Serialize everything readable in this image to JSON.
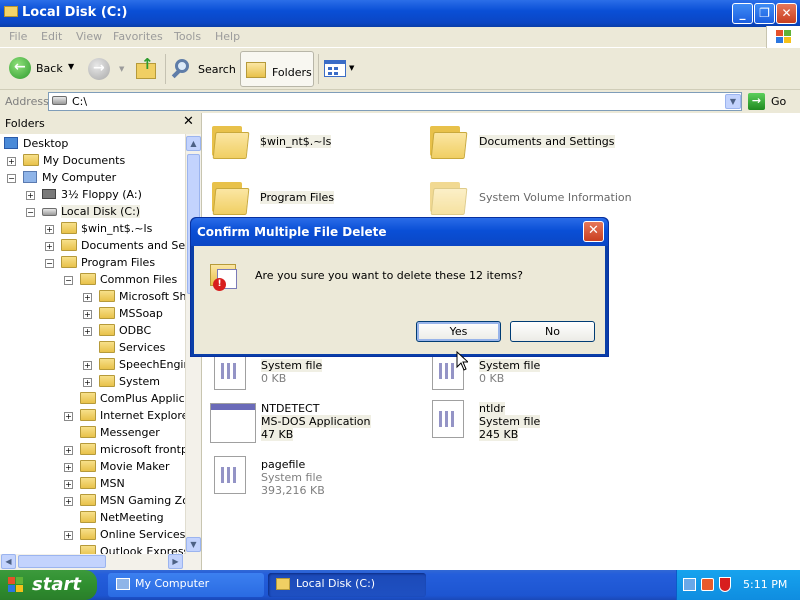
{
  "window": {
    "title": "Local Disk (C:)"
  },
  "menu": [
    "File",
    "Edit",
    "View",
    "Favorites",
    "Tools",
    "Help"
  ],
  "toolbar": {
    "back": "Back",
    "search": "Search",
    "folders": "Folders"
  },
  "address": {
    "label": "Address",
    "value": "C:\\",
    "go": "Go"
  },
  "folders_pane": {
    "title": "Folders",
    "tree": [
      {
        "label": "Desktop"
      },
      {
        "label": "My Documents"
      },
      {
        "label": "My Computer"
      },
      {
        "label": "3½ Floppy (A:)"
      },
      {
        "label": "Local Disk (C:)"
      },
      {
        "label": "$win_nt$.~ls"
      },
      {
        "label": "Documents and Settir"
      },
      {
        "label": "Program Files"
      },
      {
        "label": "Common Files"
      },
      {
        "label": "Microsoft Sha"
      },
      {
        "label": "MSSoap"
      },
      {
        "label": "ODBC"
      },
      {
        "label": "Services"
      },
      {
        "label": "SpeechEngine"
      },
      {
        "label": "System"
      },
      {
        "label": "ComPlus Applicati"
      },
      {
        "label": "Internet Explorer"
      },
      {
        "label": "Messenger"
      },
      {
        "label": "microsoft frontpa"
      },
      {
        "label": "Movie Maker"
      },
      {
        "label": "MSN"
      },
      {
        "label": "MSN Gaming Zone"
      },
      {
        "label": "NetMeeting"
      },
      {
        "label": "Online Services"
      },
      {
        "label": "Outlook Express"
      }
    ]
  },
  "items": [
    {
      "name": "$win_nt$.~ls"
    },
    {
      "name": "Documents and Settings"
    },
    {
      "name": "Program Files"
    },
    {
      "name": "System Volume Information"
    },
    {
      "type": "System file",
      "size": "0 KB"
    },
    {
      "type": "System file",
      "size": "0 KB"
    },
    {
      "name": "NTDETECT",
      "type": "MS-DOS Application",
      "size": "47 KB"
    },
    {
      "name": "ntldr",
      "type": "System file",
      "size": "245 KB"
    },
    {
      "name": "pagefile",
      "type": "System file",
      "size": "393,216 KB"
    }
  ],
  "dialog": {
    "title": "Confirm Multiple File Delete",
    "message": "Are you sure you want to delete these 12 items?",
    "yes": "Yes",
    "no": "No"
  },
  "taskbar": {
    "start": "start",
    "tasks": [
      "My Computer",
      "Local Disk (C:)"
    ],
    "clock": "5:11 PM"
  }
}
